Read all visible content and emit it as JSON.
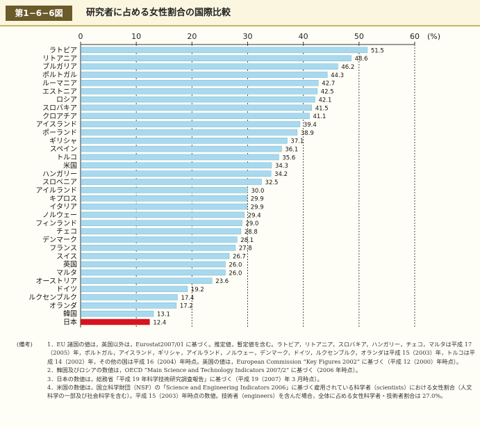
{
  "figure": {
    "number": "第1−6−6図",
    "title": "研究者に占める女性割合の国際比較"
  },
  "colors": {
    "bar": "#a9d9ef",
    "bar_stroke": "#6fb4d6",
    "highlight": "#d7141f",
    "badge": "#6b5a2a"
  },
  "chart_data": {
    "type": "bar",
    "orientation": "horizontal",
    "title": "",
    "xlabel": "",
    "ylabel": "",
    "unit": "(%)",
    "xlim": [
      0,
      60
    ],
    "xticks": [
      0,
      10,
      20,
      30,
      40,
      50,
      60
    ],
    "grid": "vertical dotted",
    "highlight_category": "日本",
    "categories": [
      "ラトビア",
      "リトアニア",
      "ブルガリア",
      "ポルトガル",
      "ルーマニア",
      "エストニア",
      "ロシア",
      "スロバキア",
      "クロアチア",
      "アイスランド",
      "ポーランド",
      "ギリシャ",
      "スペイン",
      "トルコ",
      "米国",
      "ハンガリー",
      "スロベニア",
      "アイルランド",
      "キプロス",
      "イタリア",
      "ノルウェー",
      "フィンランド",
      "チェコ",
      "デンマーク",
      "フランス",
      "スイス",
      "英国",
      "マルタ",
      "オーストリア",
      "ドイツ",
      "ルクセンブルク",
      "オランダ",
      "韓国",
      "日本"
    ],
    "values": [
      51.5,
      48.6,
      46.2,
      44.3,
      42.7,
      42.5,
      42.1,
      41.5,
      41.1,
      39.4,
      38.9,
      37.1,
      36.1,
      35.6,
      34.3,
      34.2,
      32.5,
      30.0,
      29.9,
      29.9,
      29.4,
      29.0,
      28.8,
      28.1,
      27.8,
      26.7,
      26.0,
      26.0,
      23.6,
      19.2,
      17.4,
      17.2,
      13.1,
      12.4
    ],
    "value_labels": [
      "51.5",
      "48.6",
      "46.2",
      "44.3",
      "42.7",
      "42.5",
      "42.1",
      "41.5",
      "41.1",
      "39.4",
      "38.9",
      "37.1",
      "36.1",
      "35.6",
      "34.3",
      "34.2",
      "32.5",
      "30.0",
      "29.9",
      "29.9",
      "29.4",
      "29.0",
      "28.8",
      "28.1",
      "27.8",
      "26.7",
      "26.0",
      "26.0",
      "23.6",
      "19.2",
      "17.4",
      "17.2",
      "13.1",
      "12.4"
    ]
  },
  "notes": {
    "label": "(備考)",
    "items": [
      "1．EU 諸国の値は，英国以外は，Eurostat2007/01 に基づく。推定値，暫定値を含む。ラトビア，リトアニア，スロバキア，ハンガリー，チェコ，マルタは平成 17（2005）年，ポルトガル，アイスランド，ギリシャ，アイルランド，ノルウェー，デンマーク，ドイツ，ルクセンブルク，オランダは平成 15（2003）年，トルコは平成 14（2002）年，その他の国は平成 16（2004）年時点。英国の値は，European Commission “Key Figures 2002” に基づく（平成 12（2000）年時点）。",
      "2．韓国及びロシアの数値は，OECD “Main Science and Technology Indicators 2007/2” に基づく（2006 年時点）。",
      "3．日本の数値は，総務省「平成 19 年科学技術研究調査報告」に基づく（平成 19（2007）年 3 月時点）。",
      "4．米国の数値は，国立科学財団（NSF）の「Science and Engineering Indicators 2006」に基づく雇用されている科学者（scientists）における女性割合（人文科学の一部及び社会科学を含む）。平成 15（2003）年時点の数値。技術者（engineers）を含んだ場合，全体に占める女性科学者・技術者割合は 27.0%。"
    ]
  }
}
